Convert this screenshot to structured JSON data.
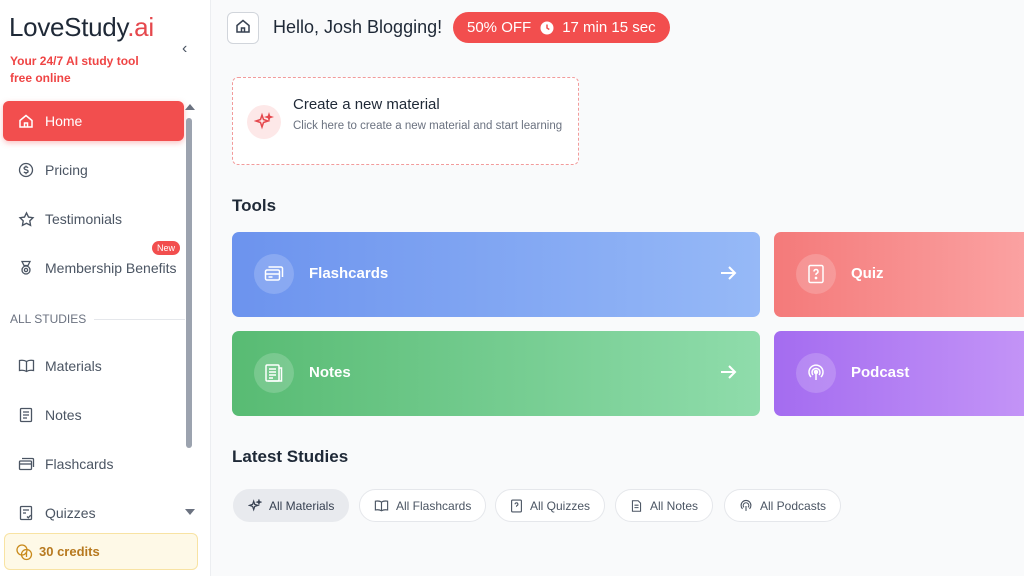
{
  "app": {
    "logo_main": "LoveStudy",
    "logo_suffix": ".ai",
    "tagline": "Your 24/7 AI study tool free online"
  },
  "sidebar": {
    "items": [
      {
        "label": "Home",
        "icon": "home-icon",
        "active": true
      },
      {
        "label": "Pricing",
        "icon": "dollar-icon"
      },
      {
        "label": "Testimonials",
        "icon": "star-icon"
      },
      {
        "label": "Membership Benefits",
        "icon": "medal-icon",
        "badge": "New"
      }
    ],
    "section_label": "ALL STUDIES",
    "study_items": [
      {
        "label": "Materials",
        "icon": "book-icon"
      },
      {
        "label": "Notes",
        "icon": "notes-icon"
      },
      {
        "label": "Flashcards",
        "icon": "flashcards-icon"
      },
      {
        "label": "Quizzes",
        "icon": "quiz-icon"
      }
    ],
    "credits": "30 credits"
  },
  "header": {
    "greeting": "Hello, Josh Blogging!",
    "promo_discount": "50% OFF",
    "promo_timer": "17 min 15 sec"
  },
  "create": {
    "title": "Create a new material",
    "subtitle": "Click here to create a new material and start learning"
  },
  "tools": {
    "heading": "Tools",
    "items": [
      {
        "label": "Flashcards",
        "color": "#6c93ee"
      },
      {
        "label": "Quiz",
        "color": "#f47a7a"
      },
      {
        "label": "Notes",
        "color": "#58bb73"
      },
      {
        "label": "Podcast",
        "color": "#a46cf0"
      }
    ]
  },
  "latest": {
    "heading": "Latest Studies",
    "filters": [
      "All Materials",
      "All Flashcards",
      "All Quizzes",
      "All Notes",
      "All Podcasts"
    ],
    "active_filter": "All Materials"
  },
  "colors": {
    "accent": "#f24e4e"
  }
}
